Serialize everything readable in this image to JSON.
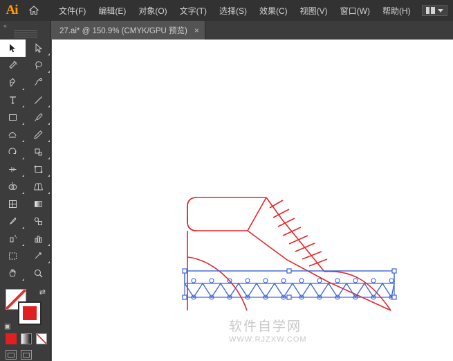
{
  "app": {
    "name": "Adobe Illustrator",
    "logo_text": "Ai",
    "home_icon": "home-icon"
  },
  "menubar": {
    "items": [
      {
        "label": "文件(F)",
        "name": "menu-file"
      },
      {
        "label": "编辑(E)",
        "name": "menu-edit"
      },
      {
        "label": "对象(O)",
        "name": "menu-object"
      },
      {
        "label": "文字(T)",
        "name": "menu-type"
      },
      {
        "label": "选择(S)",
        "name": "menu-select"
      },
      {
        "label": "效果(C)",
        "name": "menu-effect"
      },
      {
        "label": "视图(V)",
        "name": "menu-view"
      },
      {
        "label": "窗口(W)",
        "name": "menu-window"
      },
      {
        "label": "帮助(H)",
        "name": "menu-help"
      }
    ],
    "arrange_documents_icon": "grid-icon",
    "arrange_caret_icon": "chevron-down-icon"
  },
  "tabbar": {
    "tab_title": "27.ai* @ 150.9% (CMYK/GPU 预览)",
    "close_label": "×"
  },
  "toolbar": {
    "tools": [
      "selection-tool",
      "direct-selection-tool",
      "magic-wand-tool",
      "lasso-tool",
      "pen-tool",
      "curvature-tool",
      "type-tool",
      "line-segment-tool",
      "rectangle-tool",
      "paintbrush-tool",
      "shaper-tool",
      "pencil-tool",
      "rotate-tool",
      "scale-tool",
      "width-tool",
      "free-transform-tool",
      "shape-builder-tool",
      "perspective-grid-tool",
      "mesh-tool",
      "gradient-tool",
      "eyedropper-tool",
      "blend-tool",
      "symbol-sprayer-tool",
      "column-graph-tool",
      "artboard-tool",
      "slice-tool",
      "hand-tool",
      "zoom-tool"
    ],
    "selected_tool": "selection-tool",
    "fill_color": "#ffffff",
    "stroke_color": "#e02020",
    "swap_icon": "swap-fill-stroke-icon",
    "default_icon": "default-fill-stroke-icon",
    "modes": [
      "color-mode",
      "gradient-mode",
      "none-mode"
    ],
    "screen_modes": [
      "screen-mode-normal",
      "screen-mode-full"
    ]
  },
  "canvas": {
    "zoom_label": "150.9%",
    "artwork_name": "boot-outline-artwork",
    "stroke_color": "#e8252a",
    "selection_color": "#3a63d8",
    "watermark": "软件自学网",
    "watermark_sub": "WWW.RJZXW.COM"
  }
}
